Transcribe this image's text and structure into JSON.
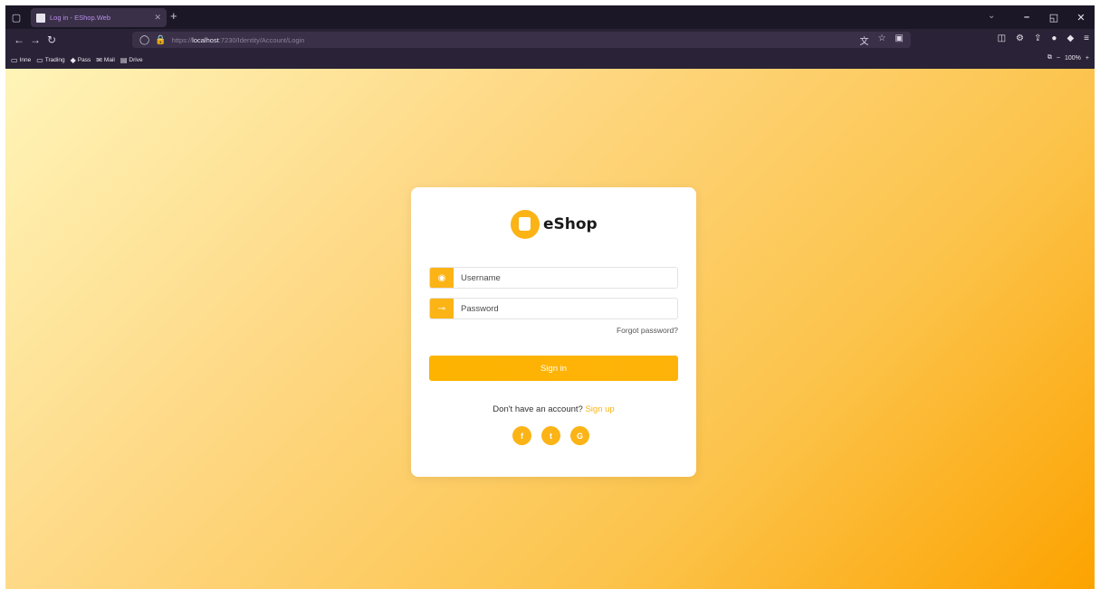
{
  "browser": {
    "tab_title": "Log in - EShop.Web",
    "new_tab_icon": "plus-icon",
    "url_prefix": "https://",
    "url_host": "localhost",
    "url_rest": ":7230/Identity/Account/Login",
    "bookmarks": [
      "Inne",
      "Trading",
      "Pass",
      "Mail",
      "Drive"
    ],
    "zoom": "100%"
  },
  "login": {
    "brand": "eShop",
    "username_placeholder": "Username",
    "password_placeholder": "Password",
    "forgot": "Forgot password?",
    "signin": "Sign in",
    "no_account": "Don't have an account?",
    "signup": "Sign up",
    "social": [
      "f",
      "t",
      "G"
    ]
  },
  "colors": {
    "accent": "#fbb316",
    "chrome": "#1f1a2c"
  }
}
